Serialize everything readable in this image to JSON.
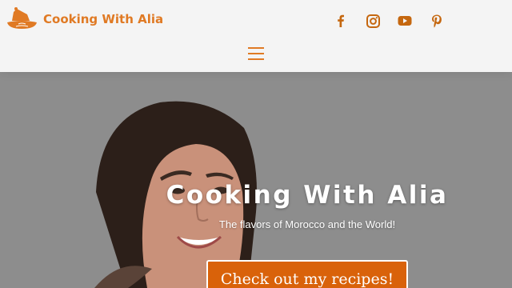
{
  "colors": {
    "accent": "#e07a24",
    "social_icon": "#c5670f",
    "hero_overlay": "#8d8d8d",
    "cta_background": "#d9620a",
    "header_background": "#f4f4f4"
  },
  "header": {
    "logo_text": "Cooking With Alia",
    "logo_icon": "tagine-icon",
    "social_links": [
      {
        "icon": "facebook-icon"
      },
      {
        "icon": "instagram-icon"
      },
      {
        "icon": "youtube-icon"
      },
      {
        "icon": "pinterest-icon"
      }
    ],
    "menu_icon": "hamburger-menu-icon"
  },
  "hero": {
    "title": "Cooking With Alia",
    "subtitle": "The flavors of Morocco and the World!",
    "cta_label": "Check out my recipes!"
  }
}
